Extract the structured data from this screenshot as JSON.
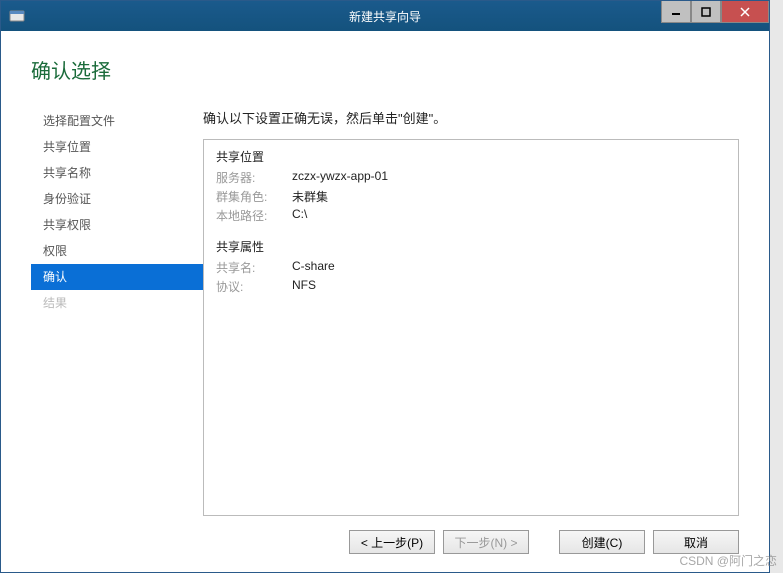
{
  "window": {
    "title": "新建共享向导"
  },
  "page": {
    "title": "确认选择",
    "instruction": "确认以下设置正确无误，然后单击\"创建\"。"
  },
  "sidebar": {
    "items": [
      {
        "label": "选择配置文件",
        "state": "normal"
      },
      {
        "label": "共享位置",
        "state": "normal"
      },
      {
        "label": "共享名称",
        "state": "normal"
      },
      {
        "label": "身份验证",
        "state": "normal"
      },
      {
        "label": "共享权限",
        "state": "normal"
      },
      {
        "label": "权限",
        "state": "normal"
      },
      {
        "label": "确认",
        "state": "active"
      },
      {
        "label": "结果",
        "state": "disabled"
      }
    ]
  },
  "details": {
    "sections": [
      {
        "title": "共享位置",
        "rows": [
          {
            "label": "服务器:",
            "value": "zczx-ywzx-app-01"
          },
          {
            "label": "群集角色:",
            "value": "未群集"
          },
          {
            "label": "本地路径:",
            "value": "C:\\"
          }
        ]
      },
      {
        "title": "共享属性",
        "rows": [
          {
            "label": "共享名:",
            "value": "C-share"
          },
          {
            "label": "协议:",
            "value": "NFS"
          }
        ]
      }
    ]
  },
  "buttons": {
    "previous": "< 上一步(P)",
    "next": "下一步(N) >",
    "create": "创建(C)",
    "cancel": "取消"
  },
  "watermark": "CSDN @阿门之恋"
}
